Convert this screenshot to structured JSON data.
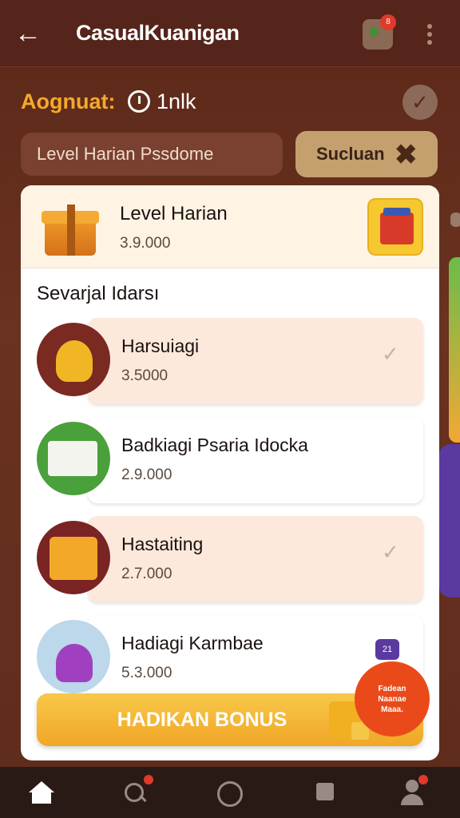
{
  "header": {
    "title": "CasualKuanigan",
    "notification_badge": "8"
  },
  "balance": {
    "label": "Aognuat:",
    "value": "1nlk"
  },
  "search": {
    "text": "Level Harian  Pssdome"
  },
  "filter": {
    "label": "Sucluan"
  },
  "featured": {
    "title": "Level Harian",
    "amount": "3.9.000"
  },
  "section": {
    "title": "Sevarjal Idarsı"
  },
  "items": [
    {
      "name": "Harsuiagi",
      "amount": "3.5000",
      "highlighted": true,
      "checked": true
    },
    {
      "name": "Badkiagi Psaria Idocka",
      "amount": "2.9.000",
      "highlighted": false,
      "checked": false
    },
    {
      "name": "Hastaiting",
      "amount": "2.7.000",
      "highlighted": true,
      "checked": true
    },
    {
      "name": "Hadiagi Karmbae",
      "amount": "5.3.000",
      "highlighted": false,
      "checked": false
    }
  ],
  "bonus_button": {
    "label": "HADIKAN BONUS"
  },
  "promo": {
    "text": "Fadean Naanae Maaa.",
    "tag": "21"
  },
  "colors": {
    "accent": "#f4a92a",
    "background": "#5a2a1a",
    "button": "#f1a626",
    "promo": "#ea4a1a"
  },
  "nav": {
    "icons": [
      "home-icon",
      "search-icon",
      "circle-icon",
      "square-icon",
      "profile-icon"
    ]
  }
}
